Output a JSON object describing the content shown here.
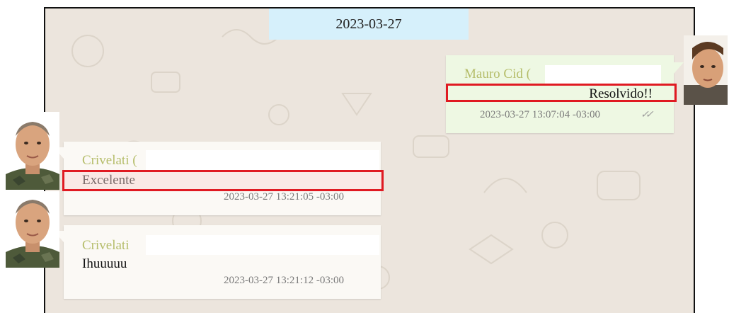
{
  "chat": {
    "date": "2023-03-27",
    "messages": [
      {
        "sender": "Mauro Cid (",
        "text": "Resolvido!!",
        "time": "2023-03-27 13:07:04 -03:00",
        "ticks": "✓✓",
        "direction": "outgoing"
      },
      {
        "sender": "Crivelati (",
        "text": "Excelente",
        "time": "2023-03-27 13:21:05 -03:00",
        "direction": "incoming"
      },
      {
        "sender": "Crivelati",
        "text": "Ihuuuuu",
        "time": "2023-03-27 13:21:12 -03:00",
        "direction": "incoming"
      }
    ]
  },
  "colors": {
    "highlight": "#e01a22",
    "sender_name": "#b5bd6a",
    "outgoing_bubble": "#eef8e3",
    "incoming_bubble": "#fbf9f5",
    "date_chip": "#d6f0fb"
  },
  "icons": [
    "read-receipt-icon"
  ]
}
